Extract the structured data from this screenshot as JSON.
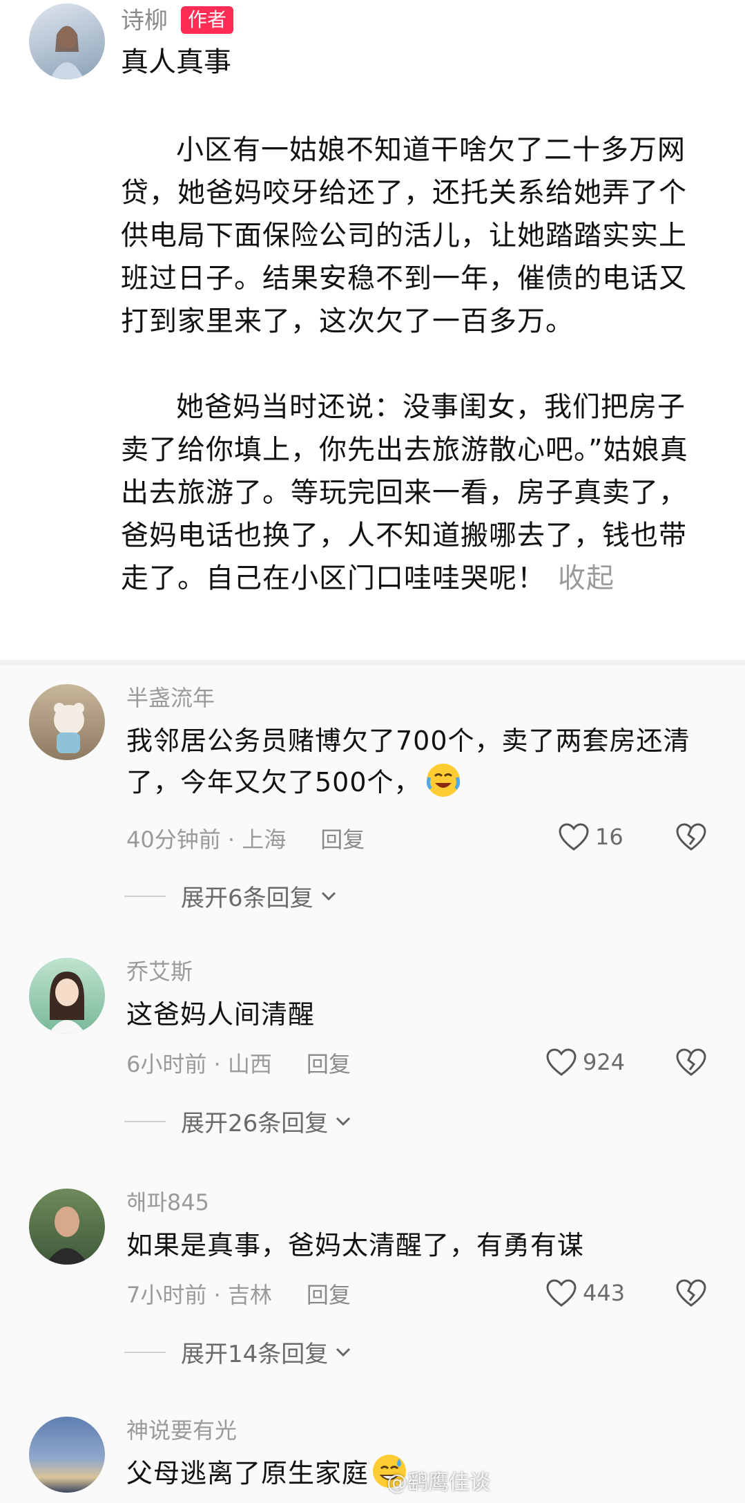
{
  "post": {
    "author": "诗柳",
    "author_tag": "作者",
    "title": "真人真事",
    "para1": "小区有一姑娘不知道干啥欠了二十多万网贷，她爸妈咬牙给还了，还托关系给她弄了个供电局下面保险公司的活儿，让她踏踏实实上班过日子。结果安稳不到一年，催债的电话又打到家里来了，这次欠了一百多万。",
    "para2": "她爸妈当时还说：没事闺女，我们把房子卖了给你填上，你先出去旅游散心吧。”姑娘真出去旅游了。等玩完回来一看，房子真卖了，爸妈电话也换了，人不知道搬哪去了，钱也带走了。自己在小区门口哇哇哭呢！",
    "collapse_label": "收起"
  },
  "comments": [
    {
      "name": "半盏流年",
      "text": "我邻居公务员赌博欠了700个，卖了两套房还清了，今年又欠了500个，",
      "time": "40分钟前",
      "location": "上海",
      "reply_label": "回复",
      "likes": "16",
      "expand": "展开6条回复",
      "emoji": "crying-laughing-emoji"
    },
    {
      "name": "乔艾斯",
      "text": "这爸妈人间清醒",
      "time": "6小时前",
      "location": "山西",
      "reply_label": "回复",
      "likes": "924",
      "expand": "展开26条回复"
    },
    {
      "name": "해파845",
      "text": "如果是真事，爸妈太清醒了，有勇有谋",
      "time": "7小时前",
      "location": "吉林",
      "reply_label": "回复",
      "likes": "443",
      "expand": "展开14条回复"
    },
    {
      "name": "神说要有光",
      "text": "父母逃离了原生家庭",
      "emoji": "sweat-smile-emoji"
    }
  ],
  "watermark": "@鹞鹰佳谈",
  "colors": {
    "author_tag_bg": "#ff2c55",
    "meta_gray": "#9a9a9a"
  }
}
